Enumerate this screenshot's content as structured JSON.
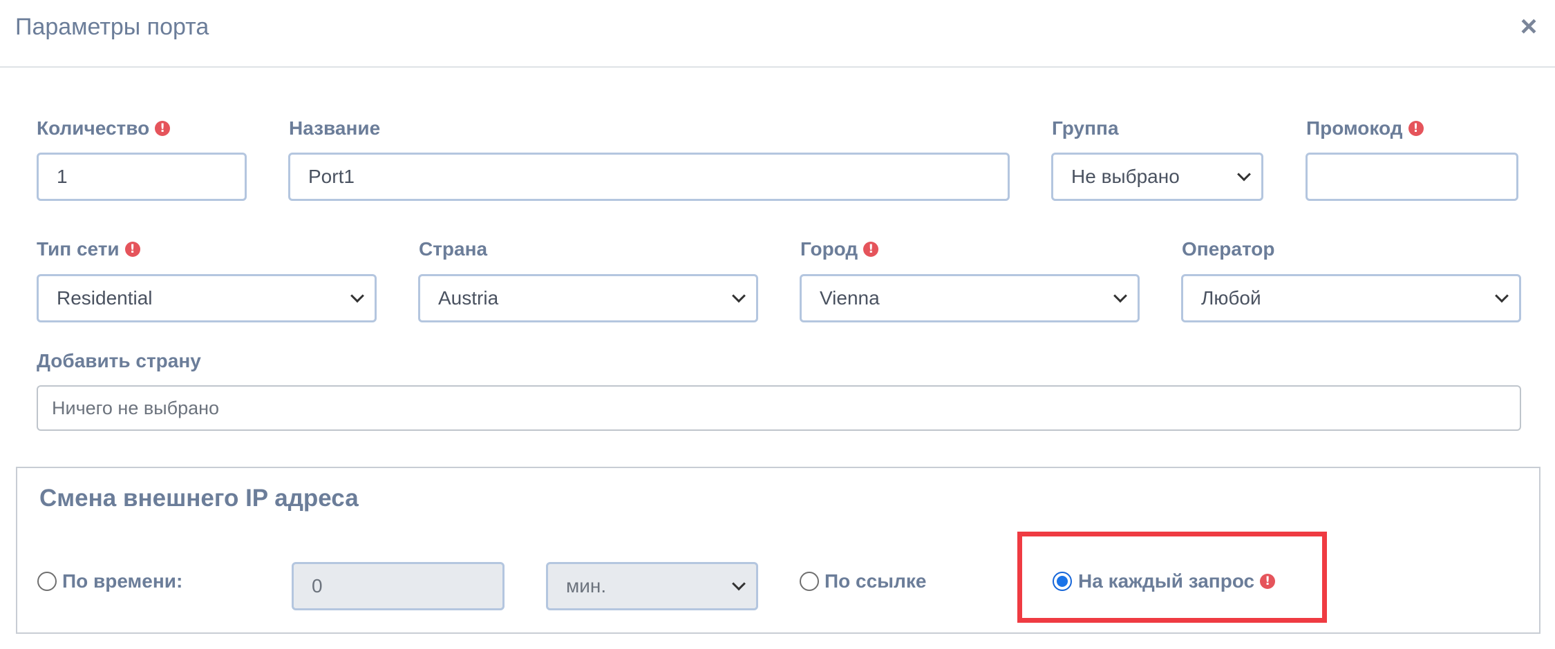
{
  "modal": {
    "title": "Параметры порта",
    "close_label": "×"
  },
  "fields": {
    "quantity": {
      "label": "Количество",
      "value": "1",
      "required": true
    },
    "name": {
      "label": "Название",
      "value": "Port1"
    },
    "group": {
      "label": "Группа",
      "value": "Не выбрано"
    },
    "promo": {
      "label": "Промокод",
      "value": "",
      "required": true
    },
    "network_type": {
      "label": "Тип сети",
      "value": "Residential",
      "required": true
    },
    "country": {
      "label": "Страна",
      "value": "Austria"
    },
    "city": {
      "label": "Город",
      "value": "Vienna",
      "required": true
    },
    "operator": {
      "label": "Оператор",
      "value": "Любой"
    },
    "add_country": {
      "label": "Добавить страну",
      "placeholder": "Ничего не выбрано"
    }
  },
  "ip_change": {
    "title": "Смена внешнего IP адреса",
    "by_time": {
      "label": "По времени:",
      "selected": false,
      "value": "0",
      "unit": "мин."
    },
    "by_link": {
      "label": "По ссылке",
      "selected": false
    },
    "per_request": {
      "label": "На каждый запрос",
      "selected": true
    }
  },
  "colors": {
    "label": "#6b7d99",
    "border": "#b4c6df",
    "warning": "#e5545b",
    "highlight": "#ef3b42",
    "radio_checked": "#1a73e8"
  }
}
